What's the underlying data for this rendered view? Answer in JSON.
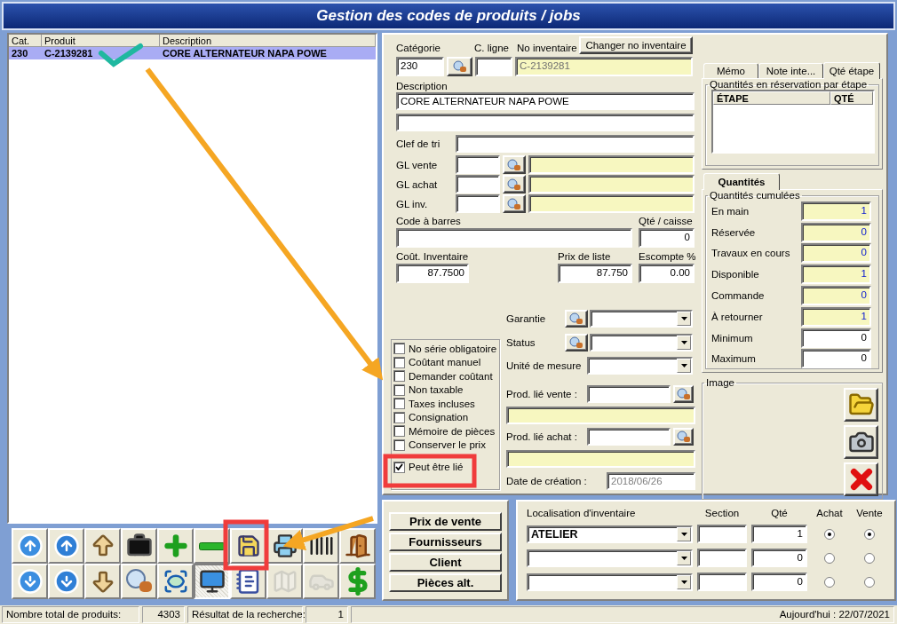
{
  "window": {
    "title": "Gestion des codes de produits / jobs"
  },
  "product_list": {
    "columns": [
      "Cat.",
      "Produit",
      "Description"
    ],
    "rows": [
      {
        "cells": [
          "230",
          "C-2139281",
          "CORE ALTERNATEUR NAPA POWE"
        ],
        "selected": true
      }
    ]
  },
  "toolbar": [
    {
      "kind": "first",
      "disabled": false,
      "pressed": false
    },
    {
      "kind": "previous",
      "disabled": false,
      "pressed": false
    },
    {
      "kind": "up",
      "disabled": false,
      "pressed": false
    },
    {
      "kind": "briefcase",
      "disabled": false,
      "pressed": false
    },
    {
      "kind": "add",
      "disabled": false,
      "pressed": false
    },
    {
      "kind": "remove",
      "disabled": false,
      "pressed": false
    },
    {
      "kind": "save",
      "disabled": false,
      "pressed": false
    },
    {
      "kind": "print",
      "disabled": false,
      "pressed": false
    },
    {
      "kind": "barcode",
      "disabled": false,
      "pressed": false
    },
    {
      "kind": "exit",
      "disabled": false,
      "pressed": false
    },
    {
      "kind": "last",
      "disabled": false,
      "pressed": false
    },
    {
      "kind": "next",
      "disabled": false,
      "pressed": false
    },
    {
      "kind": "down",
      "disabled": false,
      "pressed": false
    },
    {
      "kind": "lookup",
      "disabled": false,
      "pressed": false
    },
    {
      "kind": "view",
      "disabled": false,
      "pressed": false
    },
    {
      "kind": "monitor",
      "disabled": false,
      "pressed": true
    },
    {
      "kind": "notes",
      "disabled": false,
      "pressed": false
    },
    {
      "kind": "map",
      "disabled": true,
      "pressed": false
    },
    {
      "kind": "car",
      "disabled": true,
      "pressed": false
    },
    {
      "kind": "dollar",
      "disabled": false,
      "pressed": false
    }
  ],
  "form": {
    "categorie": {
      "label": "Catégorie",
      "value": "230"
    },
    "c_ligne": {
      "label": "C. ligne"
    },
    "no_inventaire": {
      "label": "No inventaire",
      "value": "C-2139281"
    },
    "change_button": "Changer no inventaire",
    "description": {
      "label": "Description",
      "value": "CORE ALTERNATEUR NAPA POWE"
    },
    "clef_de_tri": {
      "label": "Clef de tri"
    },
    "gl": [
      {
        "label": "GL vente"
      },
      {
        "label": "GL achat"
      },
      {
        "label": "GL inv."
      }
    ],
    "code_a_barres": {
      "label": "Code à barres"
    },
    "qte_caisse": {
      "label": "Qté / caisse",
      "value": "0"
    },
    "cout": {
      "label": "Coût. Inventaire",
      "value": "87.7500"
    },
    "prix_liste": {
      "label": "Prix de liste",
      "value": "87.750"
    },
    "escompte": {
      "label": "Escompte %",
      "value": "0.00"
    },
    "options": [
      {
        "label": "No série obligatoire",
        "checked": false
      },
      {
        "label": "Coûtant manuel",
        "checked": false
      },
      {
        "label": "Demander coûtant",
        "checked": false
      },
      {
        "label": "Non taxable",
        "checked": false
      },
      {
        "label": "Taxes incluses",
        "checked": false
      },
      {
        "label": "Consignation",
        "checked": false
      },
      {
        "label": "Mémoire de pièces",
        "checked": false
      },
      {
        "label": "Conserver le prix",
        "checked": false
      },
      {
        "label": "Peut être lié",
        "checked": true
      }
    ],
    "garantie": {
      "label": "Garantie"
    },
    "status": {
      "label": "Status"
    },
    "unite": {
      "label": "Unité de mesure"
    },
    "prod_lie_vente": {
      "label": "Prod. lié vente :"
    },
    "prod_lie_achat": {
      "label": "Prod. lié achat :"
    },
    "date_creation": {
      "label": "Date de création :",
      "value": "2018/06/26"
    }
  },
  "top_tabs": [
    {
      "label": "Mémo",
      "selected": false
    },
    {
      "label": "Note inte...",
      "selected": false
    },
    {
      "label": "Qté étape",
      "selected": true
    }
  ],
  "reservation": {
    "title": "Quantités en réservation par étape",
    "columns": [
      "ÉTAPE",
      "QTÉ"
    ]
  },
  "quantity_tabs": [
    {
      "label": "Quantités",
      "selected": true
    }
  ],
  "quantities": {
    "title": "Quantités cumulées",
    "rows": [
      {
        "label": "En main",
        "value": "1",
        "kind": "computed"
      },
      {
        "label": "Réservée",
        "value": "0",
        "kind": "computed"
      },
      {
        "label": "Travaux en cours",
        "value": "0",
        "kind": "computed"
      },
      {
        "label": "Disponible",
        "value": "1",
        "kind": "computed"
      },
      {
        "label": "Commande",
        "value": "0",
        "kind": "computed"
      },
      {
        "label": "À retourner",
        "value": "1",
        "kind": "computed"
      },
      {
        "label": "Minimum",
        "value": "0",
        "kind": "input"
      },
      {
        "label": "Maximum",
        "value": "0",
        "kind": "input"
      }
    ]
  },
  "image": {
    "title": "Image",
    "buttons": [
      {
        "kind": "folder"
      },
      {
        "kind": "camera"
      },
      {
        "kind": "delete"
      }
    ]
  },
  "action_buttons": [
    "Prix de vente",
    "Fournisseurs",
    "Client",
    "Pièces alt."
  ],
  "locations": {
    "columns": [
      "Localisation d'inventaire",
      "Section",
      "Qté",
      "Achat",
      "Vente"
    ],
    "rows": [
      {
        "location": "ATELIER",
        "quantity": "1",
        "achat": true,
        "vente": true
      },
      {
        "quantity": "0",
        "achat": false,
        "vente": false
      },
      {
        "quantity": "0",
        "achat": false,
        "vente": false
      }
    ]
  },
  "status_bar": {
    "cells": [
      "Nombre total de produits:",
      "4303",
      "Résultat de la recherche:",
      "1"
    ],
    "date": "Aujourd'hui : 22/07/2021"
  }
}
